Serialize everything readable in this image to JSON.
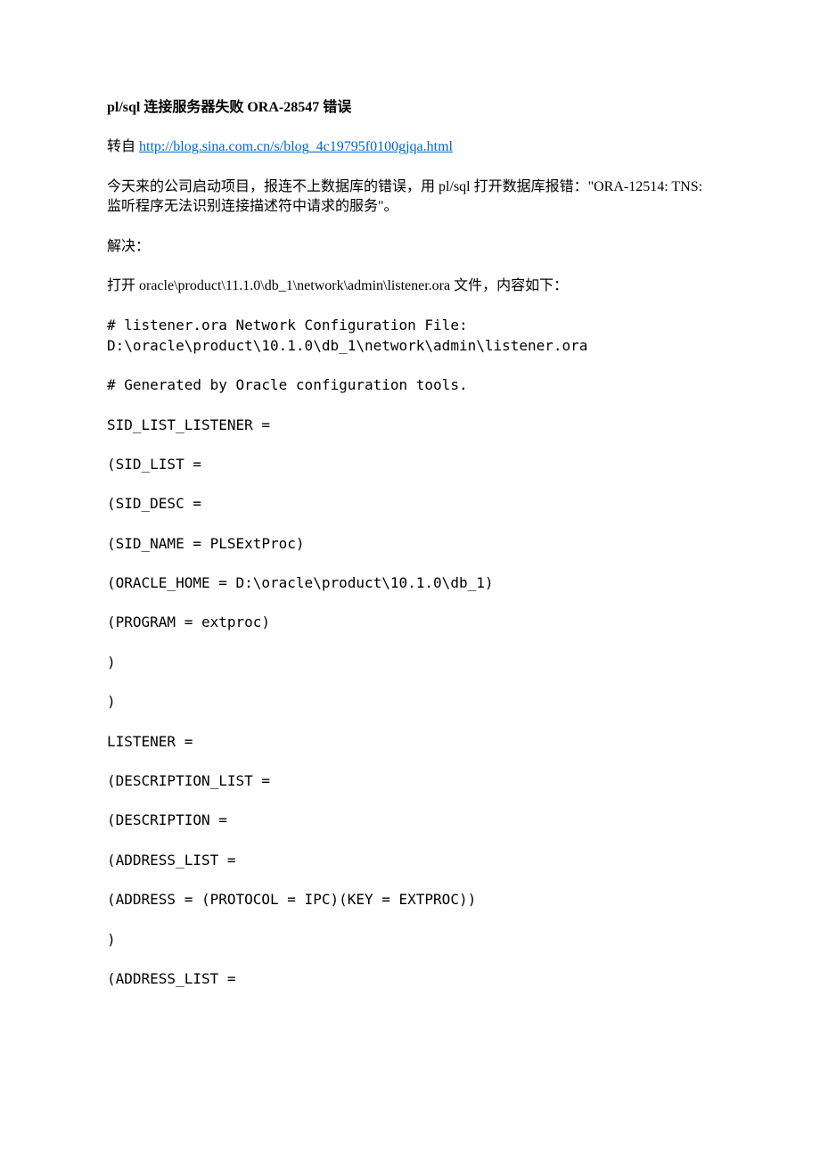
{
  "title": "pl/sql 连接服务器失败 ORA-28547 错误",
  "source_prefix": "转自 ",
  "source_link": "http://blog.sina.com.cn/s/blog_4c19795f0100gjqa.html",
  "intro": "今天来的公司启动项目，报连不上数据库的错误，用 pl/sql 打开数据库报错：\"ORA-12514: TNS: 监听程序无法识别连接描述符中请求的服务\"。",
  "resolve_label": "解决：",
  "open_file": "打开 oracle\\product\\11.1.0\\db_1\\network\\admin\\listener.ora 文件，内容如下：",
  "cfg_comment_1": "# listener.ora Network Configuration File: D:\\oracle\\product\\10.1.0\\db_1\\network\\admin\\listener.ora",
  "cfg_comment_2": "# Generated by Oracle configuration tools.",
  "cfg_lines": [
    "SID_LIST_LISTENER =",
    "(SID_LIST =",
    "(SID_DESC =",
    "(SID_NAME = PLSExtProc)",
    "(ORACLE_HOME = D:\\oracle\\product\\10.1.0\\db_1)",
    "(PROGRAM = extproc)",
    ")",
    ")",
    "LISTENER =",
    "(DESCRIPTION_LIST =",
    "(DESCRIPTION =",
    "(ADDRESS_LIST =",
    "(ADDRESS = (PROTOCOL = IPC)(KEY = EXTPROC))",
    ")",
    "(ADDRESS_LIST ="
  ]
}
